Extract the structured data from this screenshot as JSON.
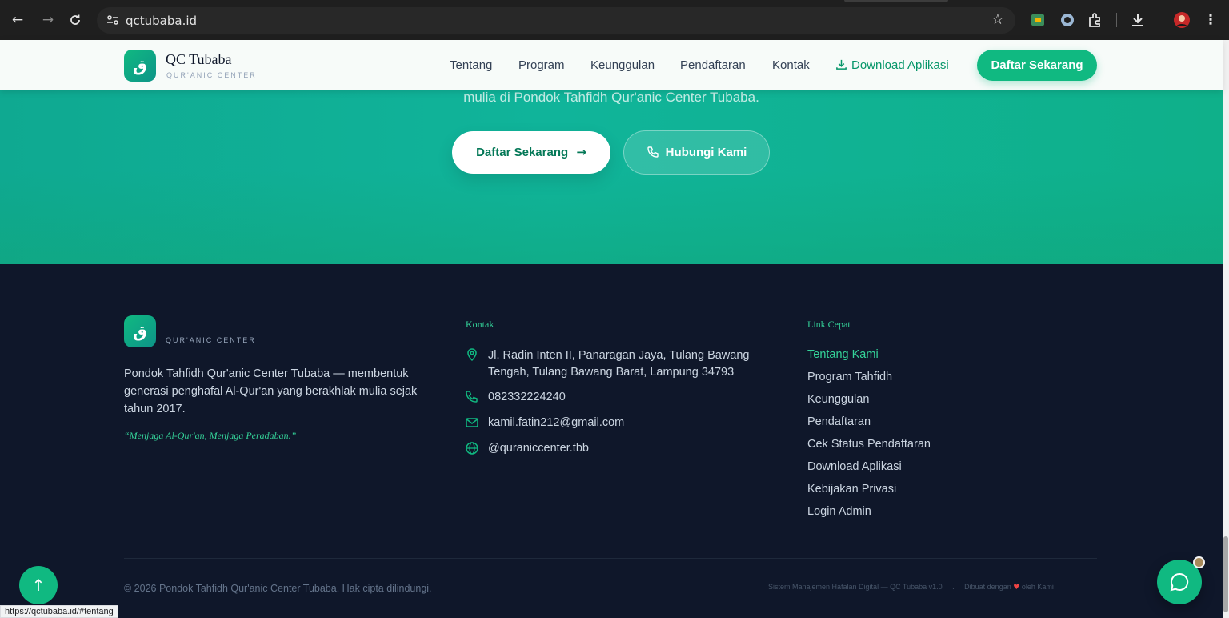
{
  "browser": {
    "url": "qctubaba.id",
    "status_url": "https://qctubaba.id/#tentang"
  },
  "header": {
    "logo_glyph": "ق",
    "brand_name": "QC Tubaba",
    "brand_sub": "QUR'ANIC CENTER",
    "nav": [
      {
        "label": "Tentang"
      },
      {
        "label": "Program"
      },
      {
        "label": "Keunggulan"
      },
      {
        "label": "Pendaftaran"
      },
      {
        "label": "Kontak"
      }
    ],
    "download_label": "Download Aplikasi",
    "cta_label": "Daftar Sekarang"
  },
  "hero": {
    "text": "mulia di Pondok Tahfidh Qur'anic Center Tubaba.",
    "primary_label": "Daftar Sekarang",
    "secondary_label": "Hubungi Kami"
  },
  "footer": {
    "logo_glyph": "ق",
    "brand_sub": "QUR'ANIC CENTER",
    "description": "Pondok Tahfidh Qur'anic Center Tubaba — membentuk generasi penghafal Al-Qur'an yang berakhlak mulia sejak tahun 2017.",
    "quote": "“Menjaga Al-Qur'an, Menjaga Peradaban.”",
    "contact_title": "Kontak",
    "contact": {
      "address": "Jl. Radin Inten II, Panaragan Jaya, Tulang Bawang Tengah, Tulang Bawang Barat, Lampung 34793",
      "phone": "082332224240",
      "email": "kamil.fatin212@gmail.com",
      "social": "@quraniccenter.tbb"
    },
    "links_title": "Link Cepat",
    "links": [
      {
        "label": "Tentang Kami"
      },
      {
        "label": "Program Tahfidh"
      },
      {
        "label": "Keunggulan"
      },
      {
        "label": "Pendaftaran"
      },
      {
        "label": "Cek Status Pendaftaran"
      },
      {
        "label": "Download Aplikasi"
      },
      {
        "label": "Kebijakan Privasi"
      },
      {
        "label": "Login Admin"
      }
    ],
    "copyright": "© 2026 Pondok Tahfidh Qur'anic Center Tubaba. Hak cipta dilindungi.",
    "system_info": "Sistem Manajemen Hafalan Digital — QC Tubaba v1.0",
    "made_prefix": "Dibuat dengan",
    "made_suffix": "oleh Kami"
  },
  "colors": {
    "accent": "#10b981",
    "footer_bg": "#0f172a",
    "link_active": "#34d399"
  },
  "icons": [
    "arrow-left-icon",
    "arrow-right-icon",
    "reload-icon",
    "site-settings-icon",
    "star-icon",
    "extension-icon",
    "download-icon",
    "profile-icon",
    "menu-icon",
    "phone-icon",
    "map-pin-icon",
    "mail-icon",
    "globe-icon",
    "heart-icon",
    "arrow-up-icon",
    "chat-icon"
  ]
}
